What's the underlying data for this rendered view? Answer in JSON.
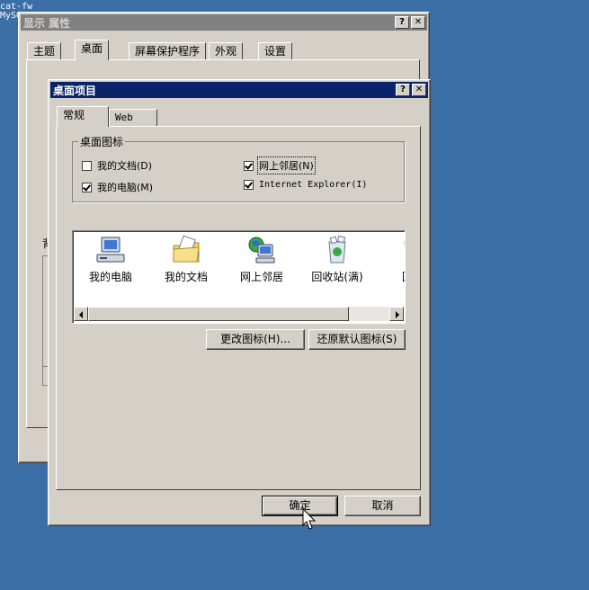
{
  "desktop": {
    "line1": "cat-fw",
    "line2": "MySQ"
  },
  "display_props": {
    "title": "显示 属性",
    "help_btn": "?",
    "close_btn": "✕",
    "tabs": [
      "主题",
      "桌面",
      "屏幕保护程序",
      "外观",
      "设置"
    ],
    "partial_label": "背"
  },
  "desktop_items": {
    "title": "桌面项目",
    "help_btn": "?",
    "close_btn": "✕",
    "tabs": [
      "常规",
      "Web"
    ],
    "icons_group": {
      "legend": "桌面图标",
      "checkboxes": [
        {
          "label": "我的文档(D)",
          "checked": false
        },
        {
          "label": "网上邻居(N)",
          "checked": true
        },
        {
          "label": "我的电脑(M)",
          "checked": true
        },
        {
          "label": "Internet Explorer(I)",
          "checked": true
        }
      ]
    },
    "icon_list": [
      {
        "label": "我的电脑",
        "icon": "my-computer-icon"
      },
      {
        "label": "我的文档",
        "icon": "my-documents-icon"
      },
      {
        "label": "网上邻居",
        "icon": "network-places-icon"
      },
      {
        "label": "回收站(满)",
        "icon": "recycle-bin-full-icon"
      },
      {
        "label": "回收",
        "icon": "recycle-bin-empty-icon"
      }
    ],
    "change_icon_btn": "更改图标(H)...",
    "restore_default_btn": "还原默认图标(S)",
    "ok_btn": "确定",
    "cancel_btn": "取消"
  }
}
